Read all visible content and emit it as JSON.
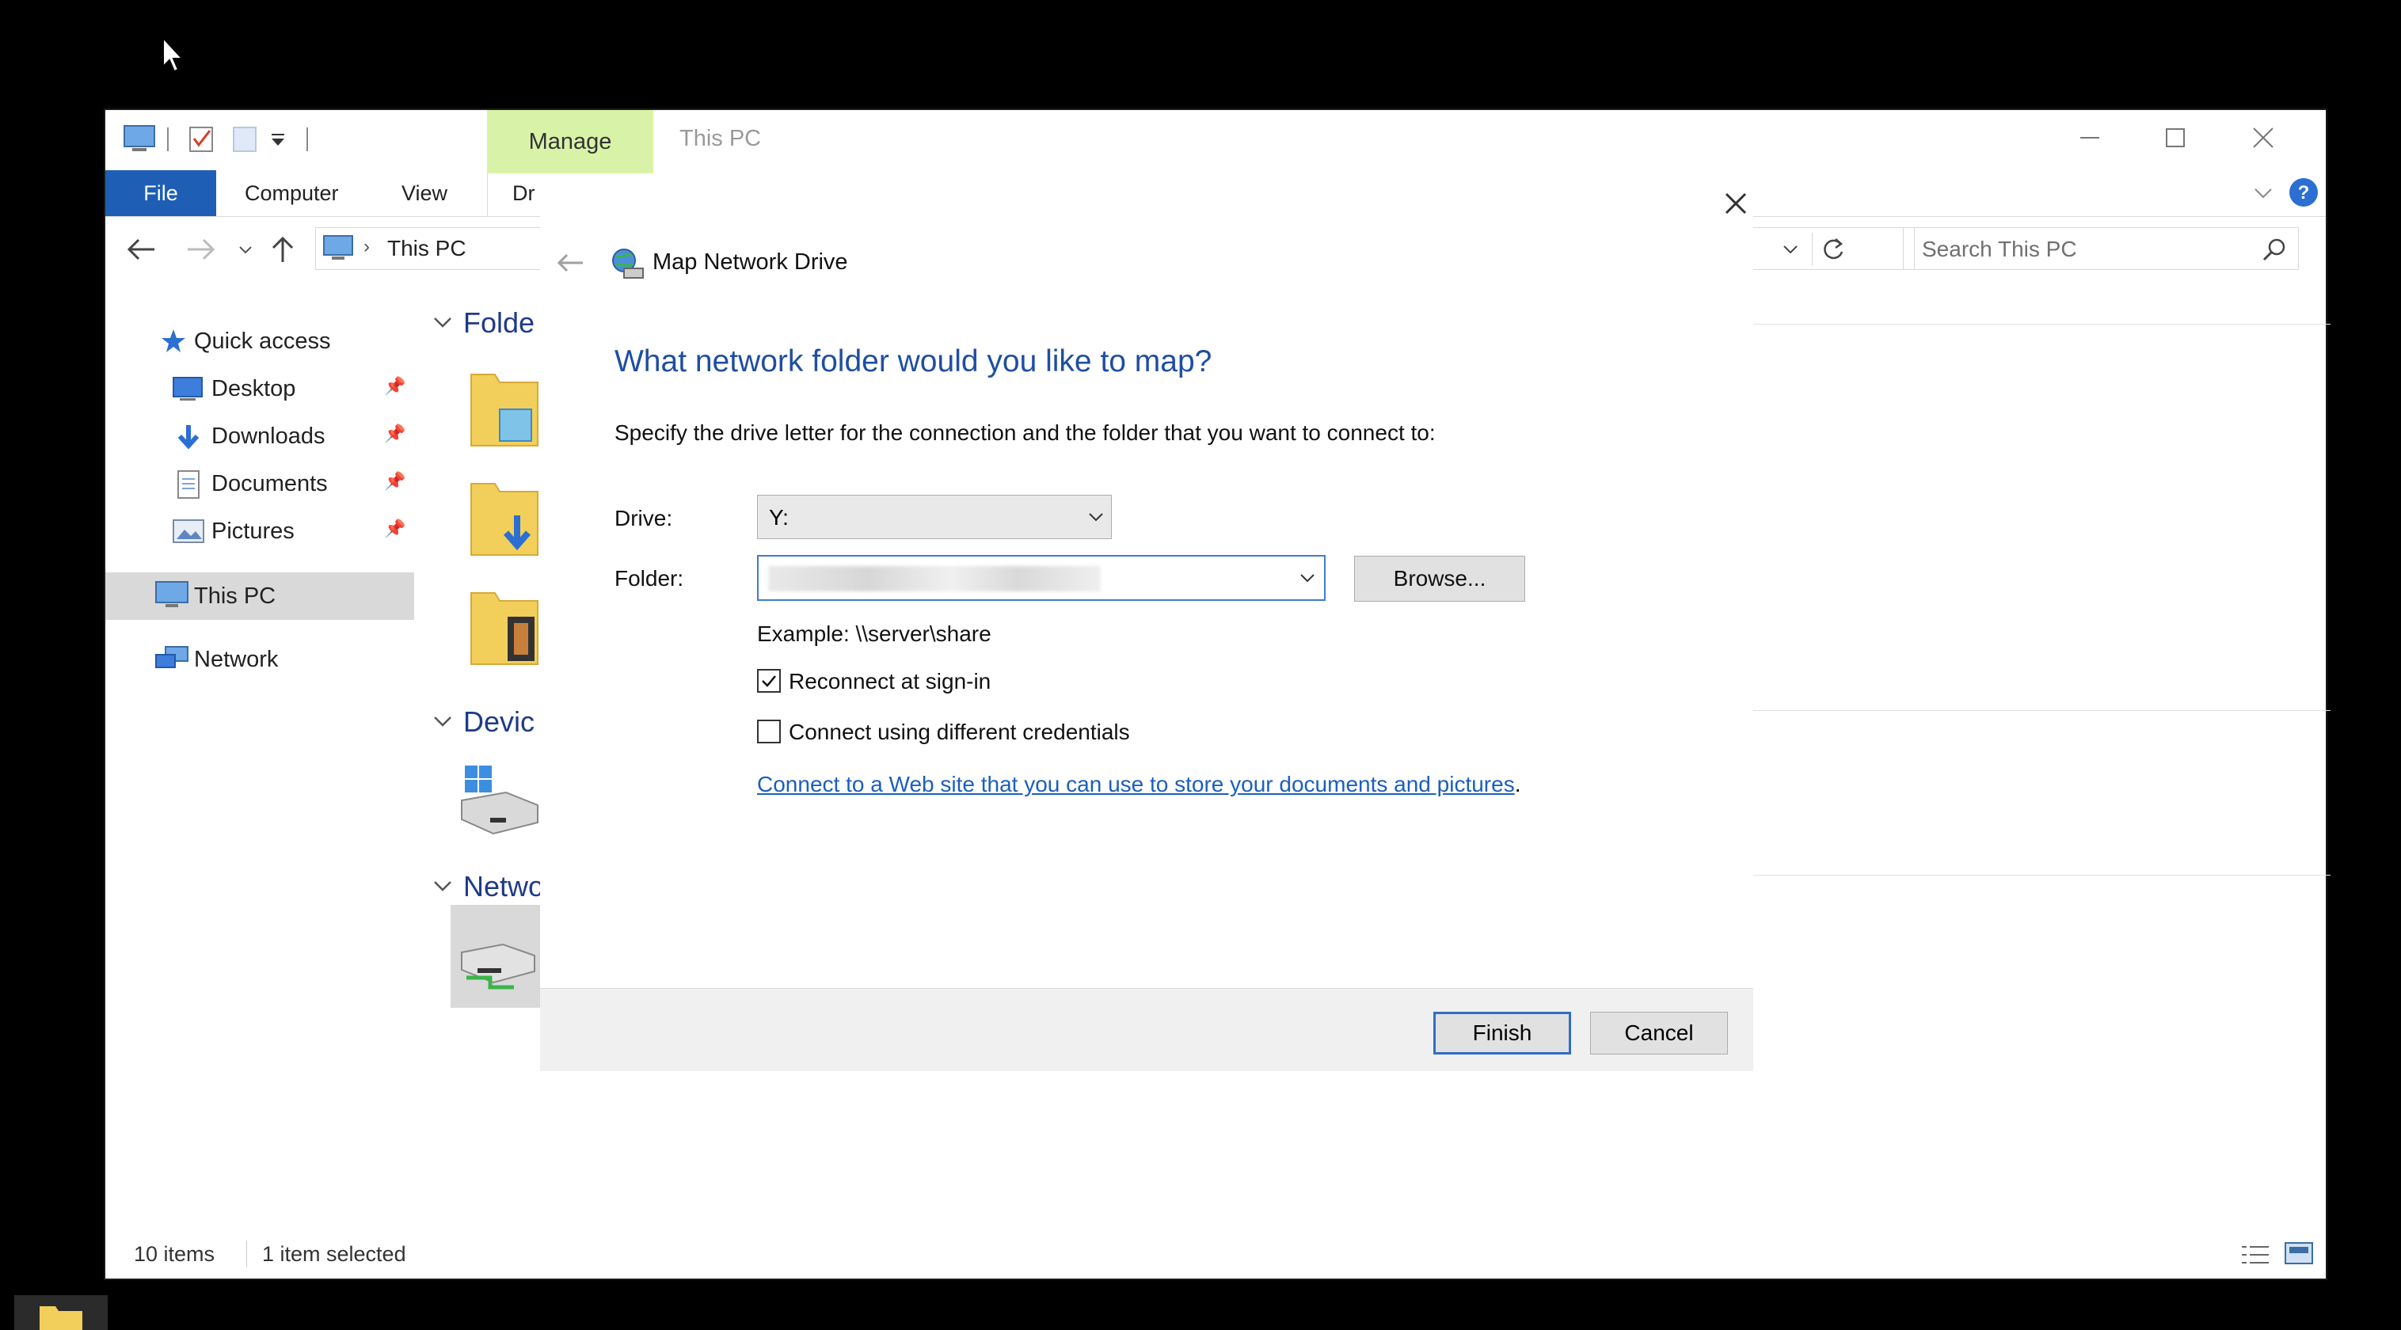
{
  "explorer": {
    "ribbon": {
      "contextual_tab": "Manage",
      "title": "This PC",
      "tabs": [
        "File",
        "Computer",
        "View",
        "Dr"
      ]
    },
    "address": {
      "location": "This PC"
    },
    "search": {
      "placeholder": "Search This PC"
    },
    "nav": {
      "quick_access": "Quick access",
      "items": [
        "Desktop",
        "Downloads",
        "Documents",
        "Pictures"
      ],
      "this_pc": "This PC",
      "network": "Network"
    },
    "content": {
      "groups": [
        "Folde",
        "Devic",
        "Netwo"
      ]
    },
    "status": {
      "items": "10 items",
      "selected": "1 item selected"
    }
  },
  "dialog": {
    "title": "Map Network Drive",
    "heading": "What network folder would you like to map?",
    "description": "Specify the drive letter for the connection and the folder that you want to connect to:",
    "drive_label": "Drive:",
    "drive_value": "Y:",
    "folder_label": "Folder:",
    "browse_label": "Browse...",
    "example": "Example: \\\\server\\share",
    "reconnect_label": "Reconnect at sign-in",
    "reconnect_checked": true,
    "credentials_label": "Connect using different credentials",
    "credentials_checked": false,
    "web_link": "Connect to a Web site that you can use to store your documents and pictures",
    "web_link_suffix": ".",
    "finish_label": "Finish",
    "cancel_label": "Cancel"
  },
  "colors": {
    "accent": "#1e5fb5",
    "heading": "#1f4ea3",
    "manage_tab": "#d8f3a7",
    "link": "#1a5fbf"
  }
}
